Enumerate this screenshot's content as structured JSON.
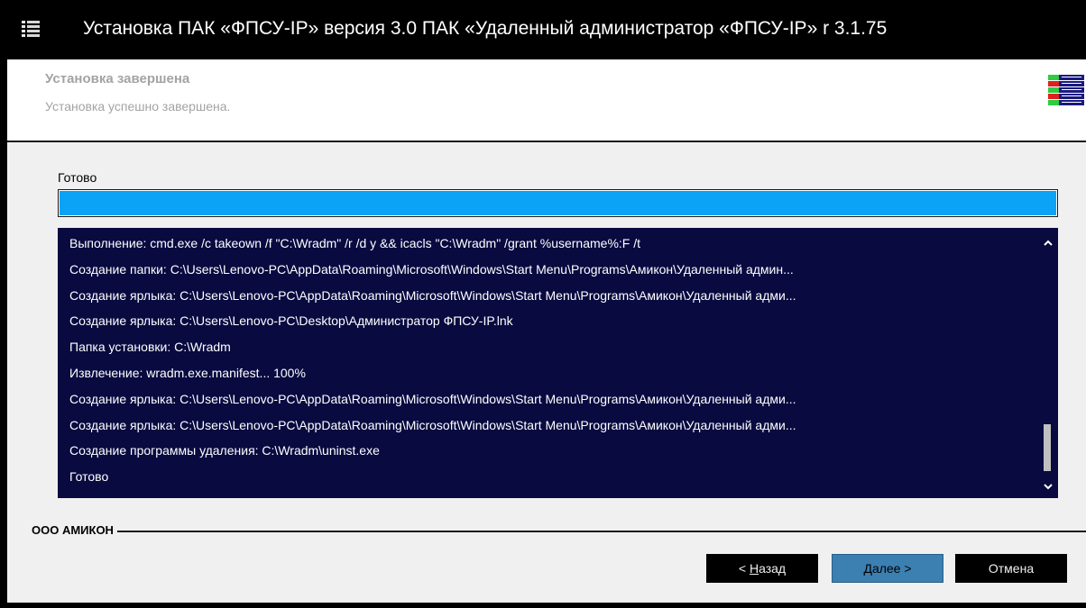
{
  "window": {
    "title": "Установка ПАК «ФПСУ-IP» версия 3.0 ПАК «Удаленный администратор «ФПСУ-IP» r 3.1.75"
  },
  "header": {
    "title": "Установка завершена",
    "subtitle": "Установка успешно завершена."
  },
  "status": {
    "label": "Готово",
    "progress_percent": 100
  },
  "log": {
    "lines": [
      "Выполнение: cmd.exe /c takeown /f \"C:\\Wradm\" /r /d y && icacls \"C:\\Wradm\" /grant %username%:F /t",
      "Создание папки: C:\\Users\\Lenovo-PC\\AppData\\Roaming\\Microsoft\\Windows\\Start Menu\\Programs\\Амикон\\Удаленный админ...",
      "Создание ярлыка: C:\\Users\\Lenovo-PC\\AppData\\Roaming\\Microsoft\\Windows\\Start Menu\\Programs\\Амикон\\Удаленный адми...",
      "Создание ярлыка: C:\\Users\\Lenovo-PC\\Desktop\\Администратор ФПСУ-IP.lnk",
      "Папка установки: C:\\Wradm",
      "Извлечение: wradm.exe.manifest... 100%",
      "Создание ярлыка: C:\\Users\\Lenovo-PC\\AppData\\Roaming\\Microsoft\\Windows\\Start Menu\\Programs\\Амикон\\Удаленный адми...",
      "Создание ярлыка: C:\\Users\\Lenovo-PC\\AppData\\Roaming\\Microsoft\\Windows\\Start Menu\\Programs\\Амикон\\Удаленный адми...",
      "Создание программы удаления: C:\\Wradm\\uninst.exe",
      "Готово"
    ],
    "text_color": "#ffffff",
    "background_color": "#080a40"
  },
  "footer": {
    "company": "ООО АМИКОН"
  },
  "buttons": {
    "back": {
      "prefix": "< ",
      "accel": "Н",
      "rest": "азад"
    },
    "next": {
      "accel": "Д",
      "rest": "алее >"
    },
    "cancel": "Отмена"
  },
  "icons": {
    "app": "app-grid-icon",
    "logo": "installer-logo-icon",
    "scroll_up": "chevron-up-icon",
    "scroll_down": "chevron-down-icon"
  },
  "colors": {
    "progress": "#0aa3f5",
    "next_button": "#3c7fb1"
  }
}
